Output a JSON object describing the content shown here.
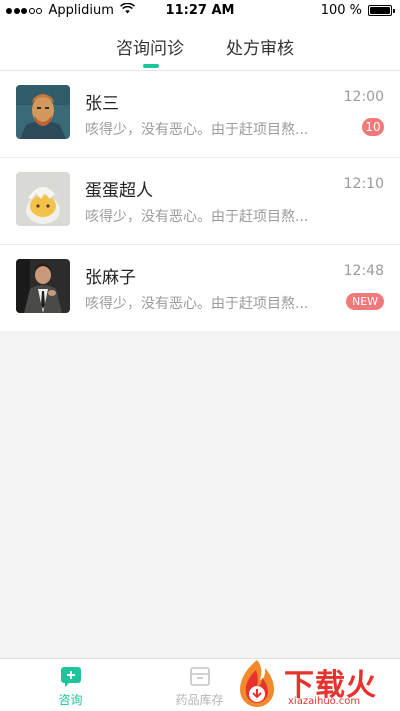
{
  "status_bar": {
    "carrier": "Applidium",
    "time": "11:27 AM",
    "battery": "100 %"
  },
  "top_tabs": [
    {
      "label": "咨询问诊",
      "active": true
    },
    {
      "label": "处方审核",
      "active": false
    }
  ],
  "accent_color": "#1fc59a",
  "badge_color": "#f07a7a",
  "chats": [
    {
      "name": "张三",
      "time": "12:00",
      "preview": "咳得少，没有恶心。由于赶项目熬...",
      "badge": "10"
    },
    {
      "name": "蛋蛋超人",
      "time": "12:10",
      "preview": "咳得少，没有恶心。由于赶项目熬...",
      "badge": ""
    },
    {
      "name": "张麻子",
      "time": "12:48",
      "preview": "咳得少，没有恶心。由于赶项目熬...",
      "badge": "NEW"
    }
  ],
  "bottom_nav": [
    {
      "label": "咨询",
      "icon": "chat-plus-icon",
      "active": true
    },
    {
      "label": "药品库存",
      "icon": "archive-box-icon",
      "active": false
    }
  ],
  "watermark": {
    "logo_text": "下载火",
    "url_text": "xiazaihuo.com"
  }
}
